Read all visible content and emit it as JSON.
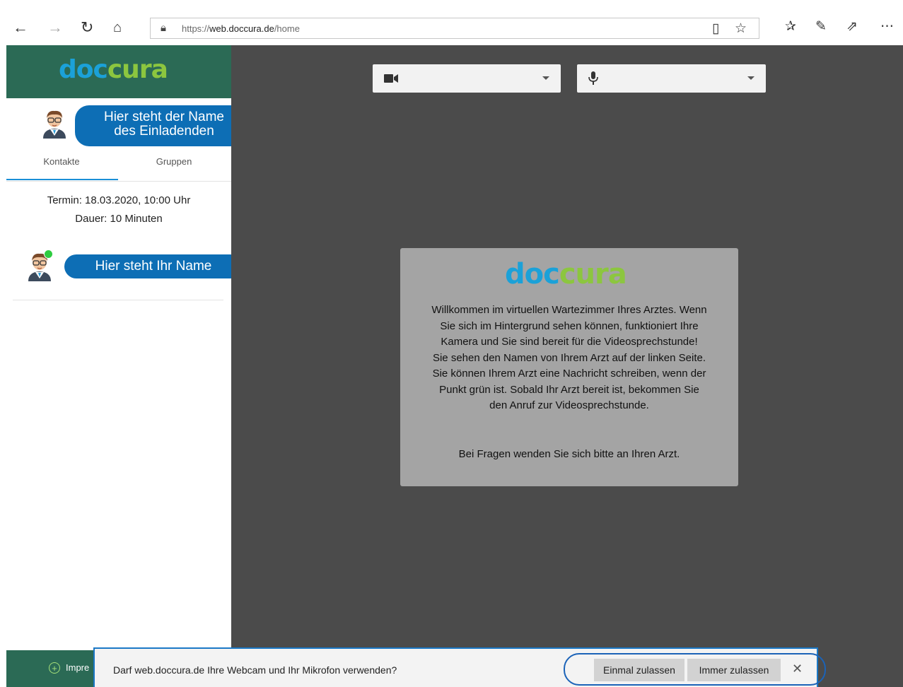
{
  "browser": {
    "url_prefix": "https://",
    "url_domain": "web.doccura.de",
    "url_path": "/home",
    "icons": [
      "back-arrow-icon",
      "forward-arrow-icon",
      "refresh-icon",
      "home-icon",
      "lock-icon",
      "reading-view-icon",
      "favorite-star-icon",
      "favorites-list-icon",
      "pen-icon",
      "share-icon",
      "more-icon"
    ]
  },
  "sidebar": {
    "logo_doc": "doc",
    "logo_cura": "cura",
    "inviter_name_line1": "Hier steht der Name",
    "inviter_name_line2": "des Einladenden",
    "tabs": [
      {
        "label": "Kontakte"
      },
      {
        "label": "Gruppen"
      }
    ],
    "appointment": "Termin: 18.03.2020, 10:00 Uhr",
    "duration": "Dauer: 10 Minuten",
    "own_name": "Hier steht Ihr Name",
    "footer_label": "Impre"
  },
  "main": {
    "camera_select": "",
    "mic_select": "",
    "welcome_logo_doc": "doc",
    "welcome_logo_cura": "cura",
    "welcome_text": "Willkommen im virtuellen Wartezimmer Ihres Arztes. Wenn\nSie sich im Hintergrund sehen können, funktioniert Ihre\nKamera und Sie sind bereit für die Videosprechstunde!\nSie sehen den Namen von Ihrem Arzt auf der linken Seite.\nSie können Ihrem Arzt eine Nachricht schreiben, wenn der\nPunkt grün ist. Sobald Ihr Arzt bereit ist, bekommen Sie\nden Anruf zur Videosprechstunde.",
    "welcome_footer": "Bei Fragen wenden Sie sich bitte an Ihren Arzt."
  },
  "permission": {
    "text": "Darf web.doccura.de Ihre Webcam und Ihr Mikrofon verwenden?",
    "allow_once": "Einmal zulassen",
    "allow_always": "Immer zulassen"
  },
  "colors": {
    "brand_green": "#2b6a55",
    "logo_blue": "#1ba1d8",
    "logo_green": "#8cc63f",
    "bubble_blue": "#0d6eb5",
    "main_bg": "#4b4b4b",
    "online_dot": "#2ecc40"
  }
}
